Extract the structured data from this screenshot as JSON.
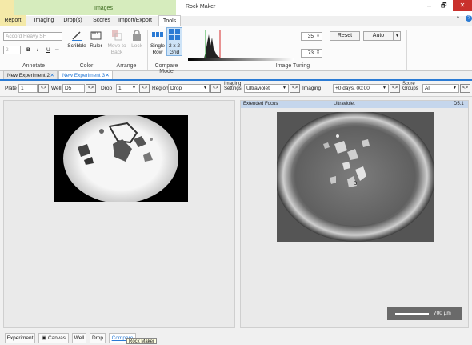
{
  "window": {
    "title": "Rock Maker",
    "context_group": "Images",
    "controls": {
      "minimize": "–",
      "restore": "🗗",
      "close": "✕"
    }
  },
  "ribbon_tabs": [
    "Report",
    "Imaging",
    "Drop(s)",
    "Scores",
    "Import/Export",
    "Tools"
  ],
  "ribbon": {
    "annotate": {
      "font": "Accord Heavy SF",
      "size": "2",
      "bold": "B",
      "italic": "I",
      "underline": "U",
      "label": "Annotate"
    },
    "color": {
      "scribble": "Scribble",
      "ruler": "Ruler",
      "label": "Color"
    },
    "arrange": {
      "move_to_back": "Move to Back",
      "lock": "Lock",
      "label": "Arrange"
    },
    "compare_mode": {
      "single_row": "Single Row",
      "grid": "2 x 2 Grid",
      "label": "Compare Mode"
    },
    "image_tuning": {
      "value_high": "35",
      "value_low": "73",
      "reset": "Reset",
      "auto": "Auto",
      "label": "Image Tuning"
    }
  },
  "doc_tabs": [
    {
      "label": "New Experiment 2",
      "close": "✕"
    },
    {
      "label": "New Experiment 3",
      "close": "✕"
    }
  ],
  "filter_bar": {
    "plate_label": "Plate",
    "plate_value": "1",
    "well_label": "Well",
    "well_value": "D5",
    "drop_label": "Drop",
    "drop_value": "1",
    "region_label": "Region",
    "region_value": "Drop",
    "imaging_settings_label": "Imaging Settings",
    "imaging_settings_value": "Ultraviolet",
    "imaging_label": "Imaging",
    "imaging_value": "+0 days, 00:00",
    "score_groups_label": "Score Groups",
    "score_groups_value": "All"
  },
  "right_panel": {
    "header_left": "Extended Focus",
    "header_center": "Ultraviolet",
    "header_right": "D5.1",
    "scale_bar": "700 µm",
    "drop_marker": "D"
  },
  "bottom_tabs": [
    "Experiment",
    "Canvas",
    "Well",
    "Drop",
    "Compare"
  ],
  "tooltip": "Rock Maker",
  "colors": {
    "accent": "#2b7bd4",
    "context_tab": "#c9e8a9",
    "close_button": "#c9302c"
  }
}
